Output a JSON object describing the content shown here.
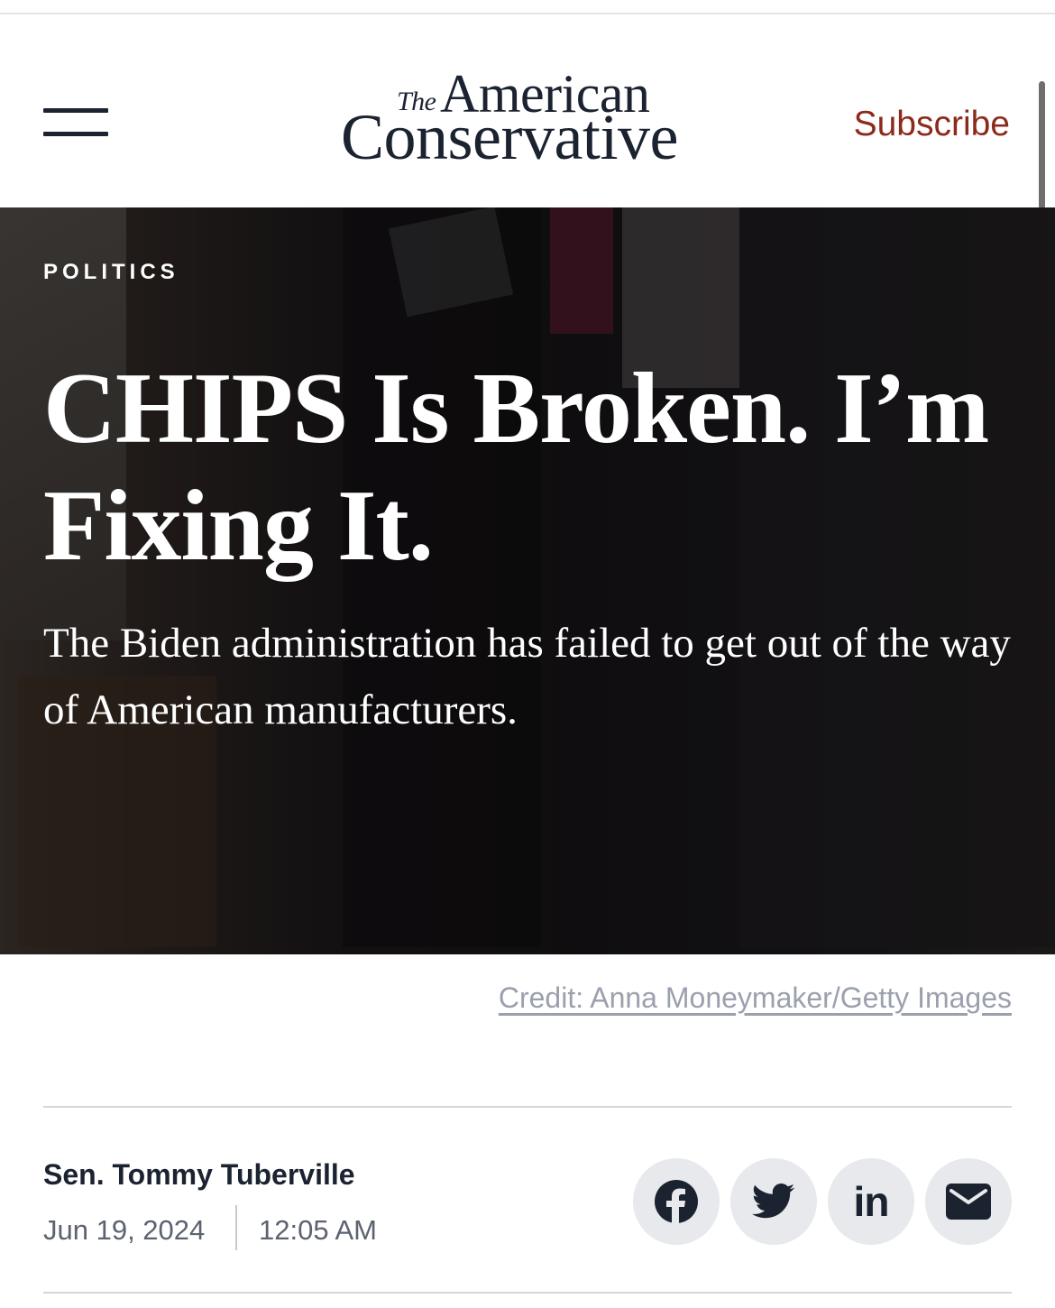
{
  "header": {
    "logo_the": "The",
    "logo_american": "American",
    "logo_conservative": "Conservative",
    "subscribe_label": "Subscribe",
    "menu_icon": "hamburger-menu-icon"
  },
  "article": {
    "category": "POLITICS",
    "headline": "CHIPS Is Broken. I’m Fixing It.",
    "dek": "The Biden administration has failed to get out of the way of American manufacturers.",
    "image_credit": "Credit: Anna Moneymaker/Getty Images",
    "author": "Sen. Tommy Tuberville",
    "date": "Jun 19, 2024",
    "time": "12:05 AM"
  },
  "share": {
    "icons": [
      "facebook-icon",
      "twitter-icon",
      "linkedin-icon",
      "email-icon"
    ],
    "linkedin_glyph": "in"
  },
  "colors": {
    "brand_navy": "#1b2230",
    "subscribe_red": "#8c2a1c",
    "share_bg": "#e8e9ec",
    "credit_gray": "#9aa0ad"
  }
}
